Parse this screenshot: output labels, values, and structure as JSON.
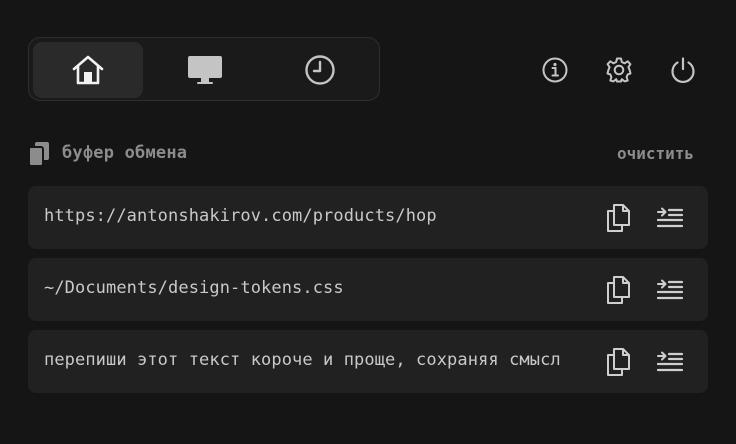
{
  "tabs": [
    {
      "name": "home",
      "icon": "home-icon",
      "active": true
    },
    {
      "name": "display",
      "icon": "monitor-icon",
      "active": false
    },
    {
      "name": "history",
      "icon": "clock-icon",
      "active": false
    }
  ],
  "toolbar": {
    "icons": [
      "info-icon",
      "gear-icon",
      "power-icon"
    ]
  },
  "clipboard": {
    "title": "буфер обмена",
    "clear_label": "очистить",
    "items": [
      {
        "text": "https://antonshakirov.com/products/hop"
      },
      {
        "text": "~/Documents/design-tokens.css"
      },
      {
        "text": "перепиши этот текст короче и проще, сохраняя смысл"
      }
    ]
  },
  "colors": {
    "background": "#151515",
    "item_background": "#212121",
    "active_tab": "#2a2a2a",
    "text": "#c9c9c9",
    "muted_text": "#8c8c8c",
    "icon": "#cfcfcf"
  }
}
